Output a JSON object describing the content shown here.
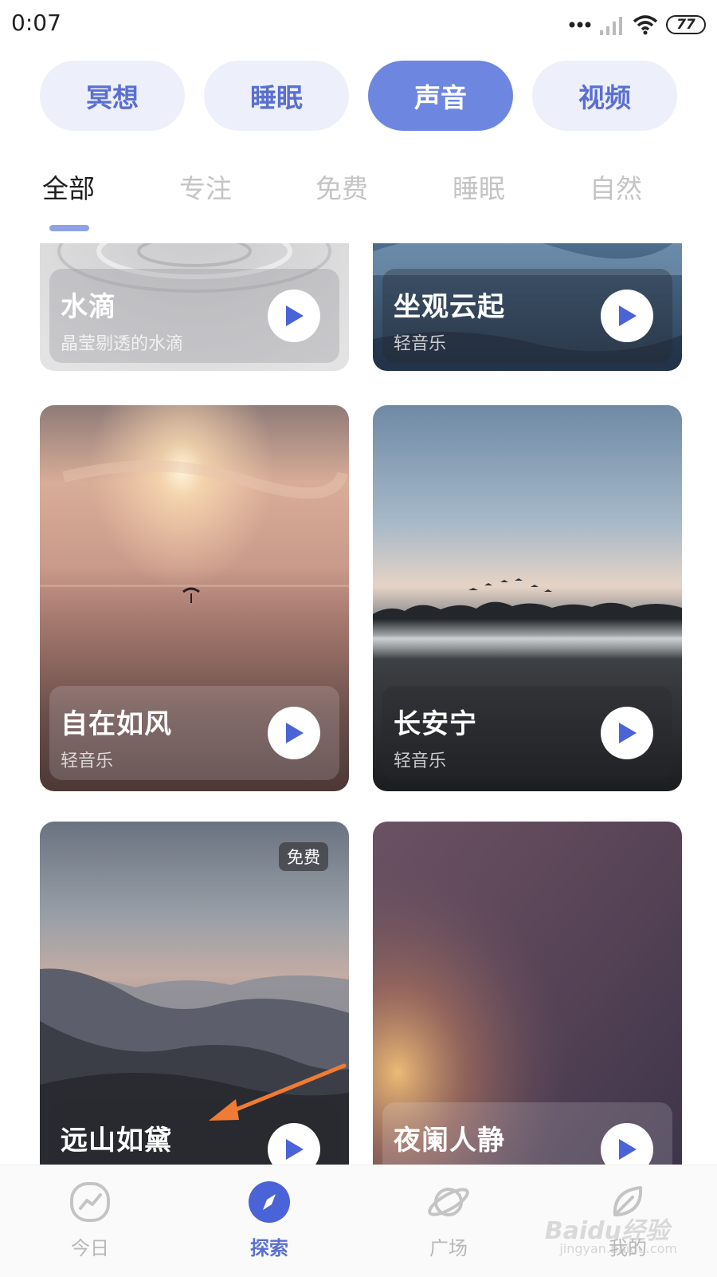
{
  "status_bar": {
    "time": "0:07",
    "battery": "77"
  },
  "top_tabs": [
    {
      "label": "冥想",
      "active": false
    },
    {
      "label": "睡眠",
      "active": false
    },
    {
      "label": "声音",
      "active": true
    },
    {
      "label": "视频",
      "active": false
    }
  ],
  "sub_tabs": [
    {
      "label": "全部",
      "active": true
    },
    {
      "label": "专注",
      "active": false
    },
    {
      "label": "免费",
      "active": false
    },
    {
      "label": "睡眠",
      "active": false
    },
    {
      "label": "自然",
      "active": false
    }
  ],
  "cards": [
    {
      "title": "水滴",
      "subtitle": "晶莹剔透的水滴",
      "image": "water-drop-ripple"
    },
    {
      "title": "坐观云起",
      "subtitle": "轻音乐",
      "image": "clouds-over-sea"
    },
    {
      "title": "自在如风",
      "subtitle": "轻音乐",
      "image": "sunset-sea-paraglider"
    },
    {
      "title": "长安宁",
      "subtitle": "轻音乐",
      "image": "misty-treeline-birds"
    },
    {
      "title": "远山如黛",
      "subtitle": "",
      "badge": "免费",
      "image": "layered-mountains"
    },
    {
      "title": "夜阑人静",
      "subtitle": "",
      "image": "night-glow"
    }
  ],
  "bottom_nav": [
    {
      "label": "今日",
      "icon": "trend-icon",
      "active": false
    },
    {
      "label": "探索",
      "icon": "compass-icon",
      "active": true
    },
    {
      "label": "广场",
      "icon": "planet-icon",
      "active": false
    },
    {
      "label": "我的",
      "icon": "leaf-icon",
      "active": false
    }
  ],
  "watermark": {
    "text": "Baidu经验",
    "sub": "jingyan.baidu.com"
  },
  "colors": {
    "accent": "#6d87e0",
    "tab_bg": "#edf0fb",
    "play_icon": "#4a63d6",
    "annotation_arrow": "#f07b34"
  }
}
